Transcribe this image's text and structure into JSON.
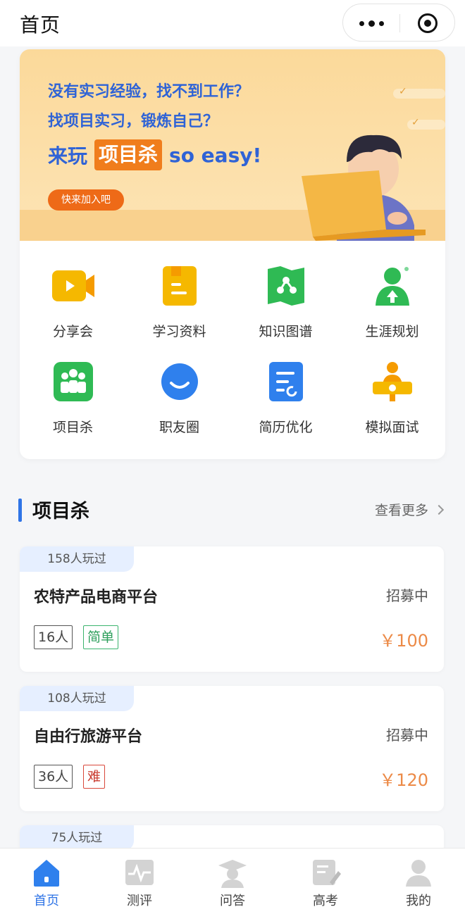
{
  "topbar": {
    "title": "首页",
    "more_icon": "more-dots-icon",
    "close_icon": "target-close-icon"
  },
  "banner": {
    "line1": "没有实习经验，找不到工作？",
    "line2": "找项目实习，锻炼自己？",
    "line3_prefix": "来玩",
    "line3_highlight": "项目杀",
    "line3_suffix": "so easy!",
    "cta": "快来加入吧",
    "colors": {
      "text": "#2f63d6",
      "highlight": "#f07d1c",
      "cta": "#ee6a17",
      "bg": "#fbd99a"
    }
  },
  "grid": [
    {
      "label": "分享会",
      "icon": "video-camera-icon"
    },
    {
      "label": "学习资料",
      "icon": "document-icon"
    },
    {
      "label": "知识图谱",
      "icon": "knowledge-map-icon"
    },
    {
      "label": "生涯规划",
      "icon": "career-person-icon"
    },
    {
      "label": "项目杀",
      "icon": "team-group-icon"
    },
    {
      "label": "职友圈",
      "icon": "smile-circle-icon"
    },
    {
      "label": "简历优化",
      "icon": "resume-icon"
    },
    {
      "label": "模拟面试",
      "icon": "interview-icon"
    }
  ],
  "section": {
    "title": "项目杀",
    "more": "查看更多"
  },
  "projects": [
    {
      "played": "158人玩过",
      "name": "农特产品电商平台",
      "status": "招募中",
      "people": "16人",
      "level": "简单",
      "price": "￥100"
    },
    {
      "played": "108人玩过",
      "name": "自由行旅游平台",
      "status": "招募中",
      "people": "36人",
      "level": "难",
      "price": "￥120"
    },
    {
      "played": "75人玩过"
    }
  ],
  "tabs": [
    {
      "label": "首页",
      "icon": "home-icon",
      "active": true
    },
    {
      "label": "测评",
      "icon": "assessment-icon",
      "active": false
    },
    {
      "label": "问答",
      "icon": "graduate-icon",
      "active": false
    },
    {
      "label": "高考",
      "icon": "exam-edit-icon",
      "active": false
    },
    {
      "label": "我的",
      "icon": "user-icon",
      "active": false
    }
  ],
  "colors": {
    "accent": "#2f74e6",
    "price": "#ec8a47",
    "easy": "#2e9f5c",
    "hard": "#c93a2e"
  }
}
